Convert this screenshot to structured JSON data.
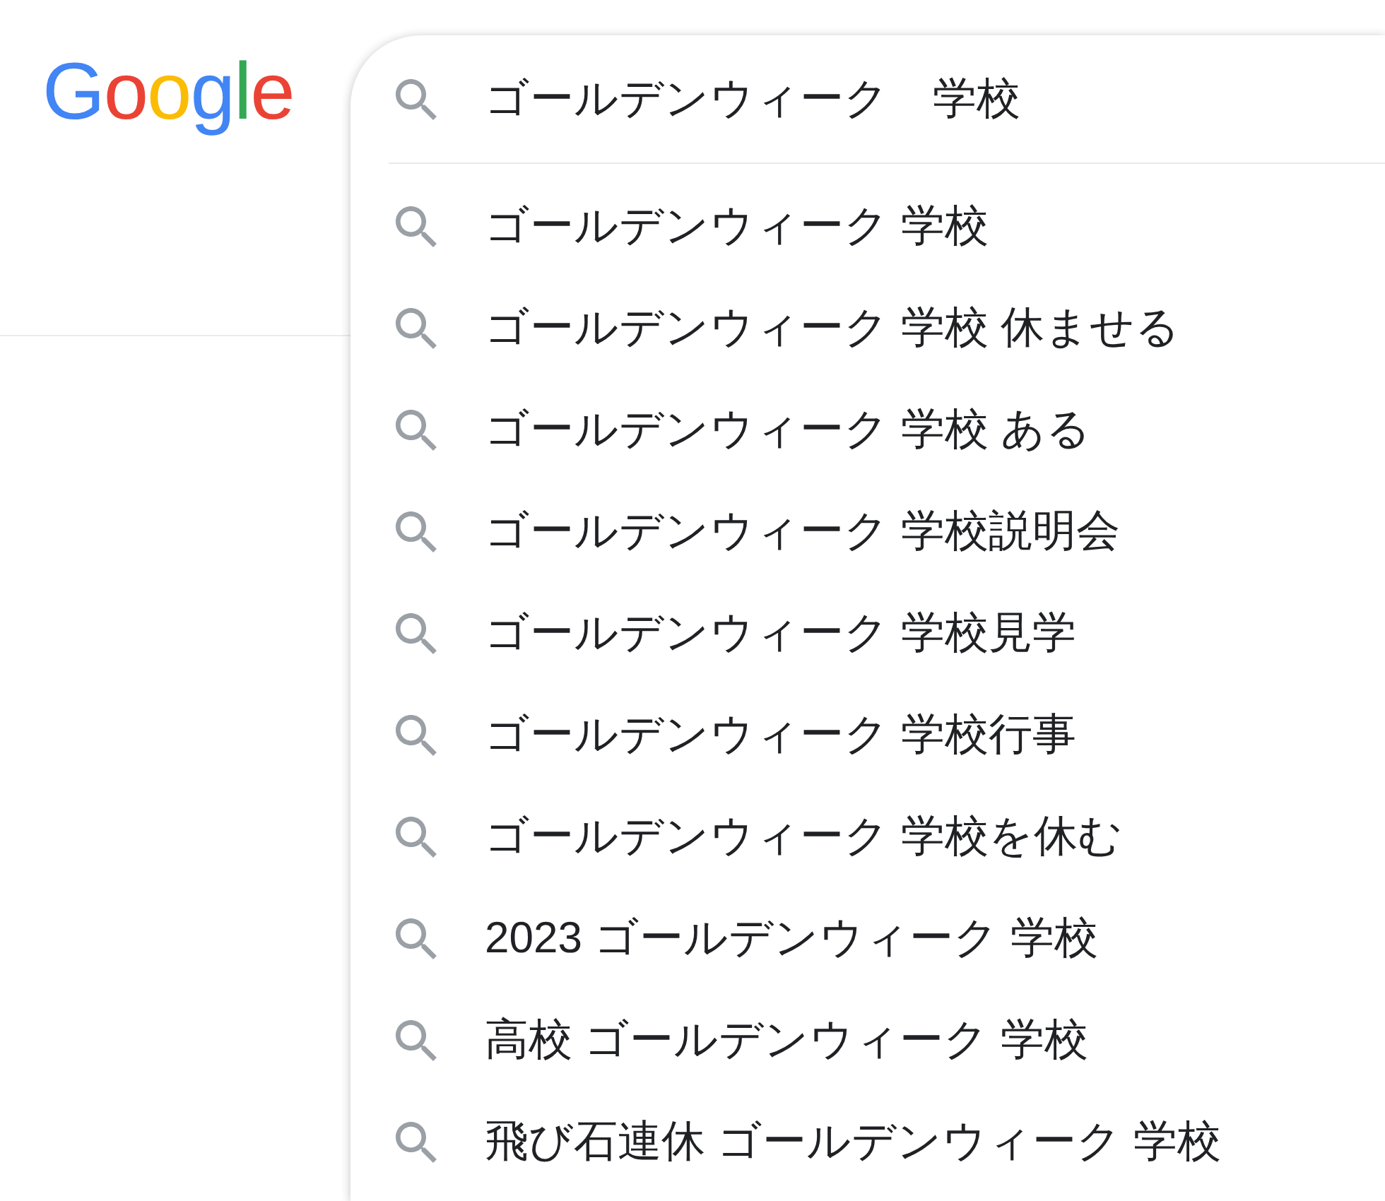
{
  "logo": {
    "text": "Google"
  },
  "search": {
    "value": "ゴールデンウィーク　学校"
  },
  "suggestions": [
    "ゴールデンウィーク 学校",
    "ゴールデンウィーク 学校 休ませる",
    "ゴールデンウィーク 学校 ある",
    "ゴールデンウィーク 学校説明会",
    "ゴールデンウィーク 学校見学",
    "ゴールデンウィーク 学校行事",
    "ゴールデンウィーク 学校を休む",
    "2023 ゴールデンウィーク 学校",
    "高校 ゴールデンウィーク 学校",
    "飛び石連休 ゴールデンウィーク 学校"
  ]
}
